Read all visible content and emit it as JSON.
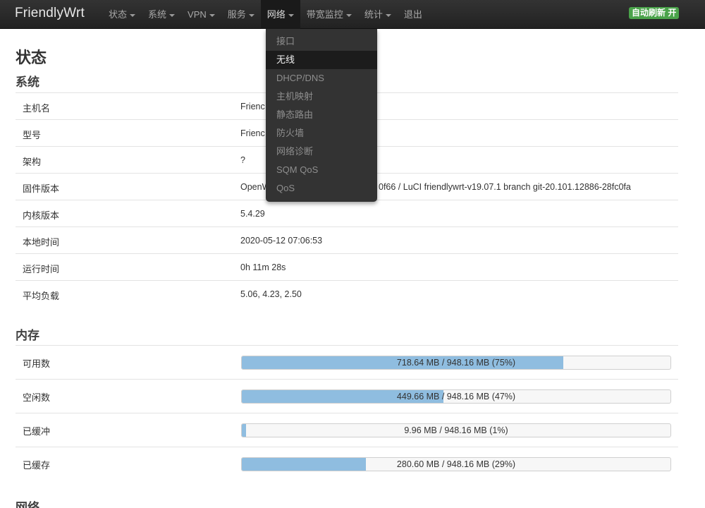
{
  "brand": "FriendlyWrt",
  "nav": {
    "items": [
      {
        "label": "状态"
      },
      {
        "label": "系统"
      },
      {
        "label": "VPN"
      },
      {
        "label": "服务"
      },
      {
        "label": "网络"
      },
      {
        "label": "带宽监控"
      },
      {
        "label": "统计"
      },
      {
        "label": "退出"
      }
    ],
    "refresh_badge": "自动刷新 开"
  },
  "dropdown": {
    "items": [
      {
        "label": "接口"
      },
      {
        "label": "无线"
      },
      {
        "label": "DHCP/DNS"
      },
      {
        "label": "主机映射"
      },
      {
        "label": "静态路由"
      },
      {
        "label": "防火墙"
      },
      {
        "label": "网络诊断"
      },
      {
        "label": "SQM QoS"
      },
      {
        "label": "QoS"
      }
    ]
  },
  "page_title": "状态",
  "system": {
    "title": "系统",
    "rows": [
      {
        "label": "主机名",
        "value": "Frienc"
      },
      {
        "label": "型号",
        "value": "Frienc"
      },
      {
        "label": "架构",
        "value": "?"
      },
      {
        "label": "固件版本",
        "value": "OpenW",
        "value_tail": "0f66 / LuCI friendlywrt-v19.07.1 branch git-20.101.12886-28fc0fa"
      },
      {
        "label": "内核版本",
        "value": "5.4.29"
      },
      {
        "label": "本地时间",
        "value": "2020-05-12 07:06:53"
      },
      {
        "label": "运行时间",
        "value": "0h 11m 28s"
      },
      {
        "label": "平均负载",
        "value": "5.06, 4.23, 2.50"
      }
    ]
  },
  "memory": {
    "title": "内存",
    "rows": [
      {
        "label": "可用数",
        "text": "718.64 MB / 948.16 MB (75%)",
        "percent": 75
      },
      {
        "label": "空闲数",
        "text": "449.66 MB / 948.16 MB (47%)",
        "percent": 47
      },
      {
        "label": "已缓冲",
        "text": "9.96 MB / 948.16 MB (1%)",
        "percent": 1
      },
      {
        "label": "已缓存",
        "text": "280.60 MB / 948.16 MB (29%)",
        "percent": 29
      }
    ]
  },
  "network": {
    "title": "网络"
  },
  "colors": {
    "navbar": "#222222",
    "badge": "#4aa34a",
    "bar_fill": "#8fbde0"
  }
}
